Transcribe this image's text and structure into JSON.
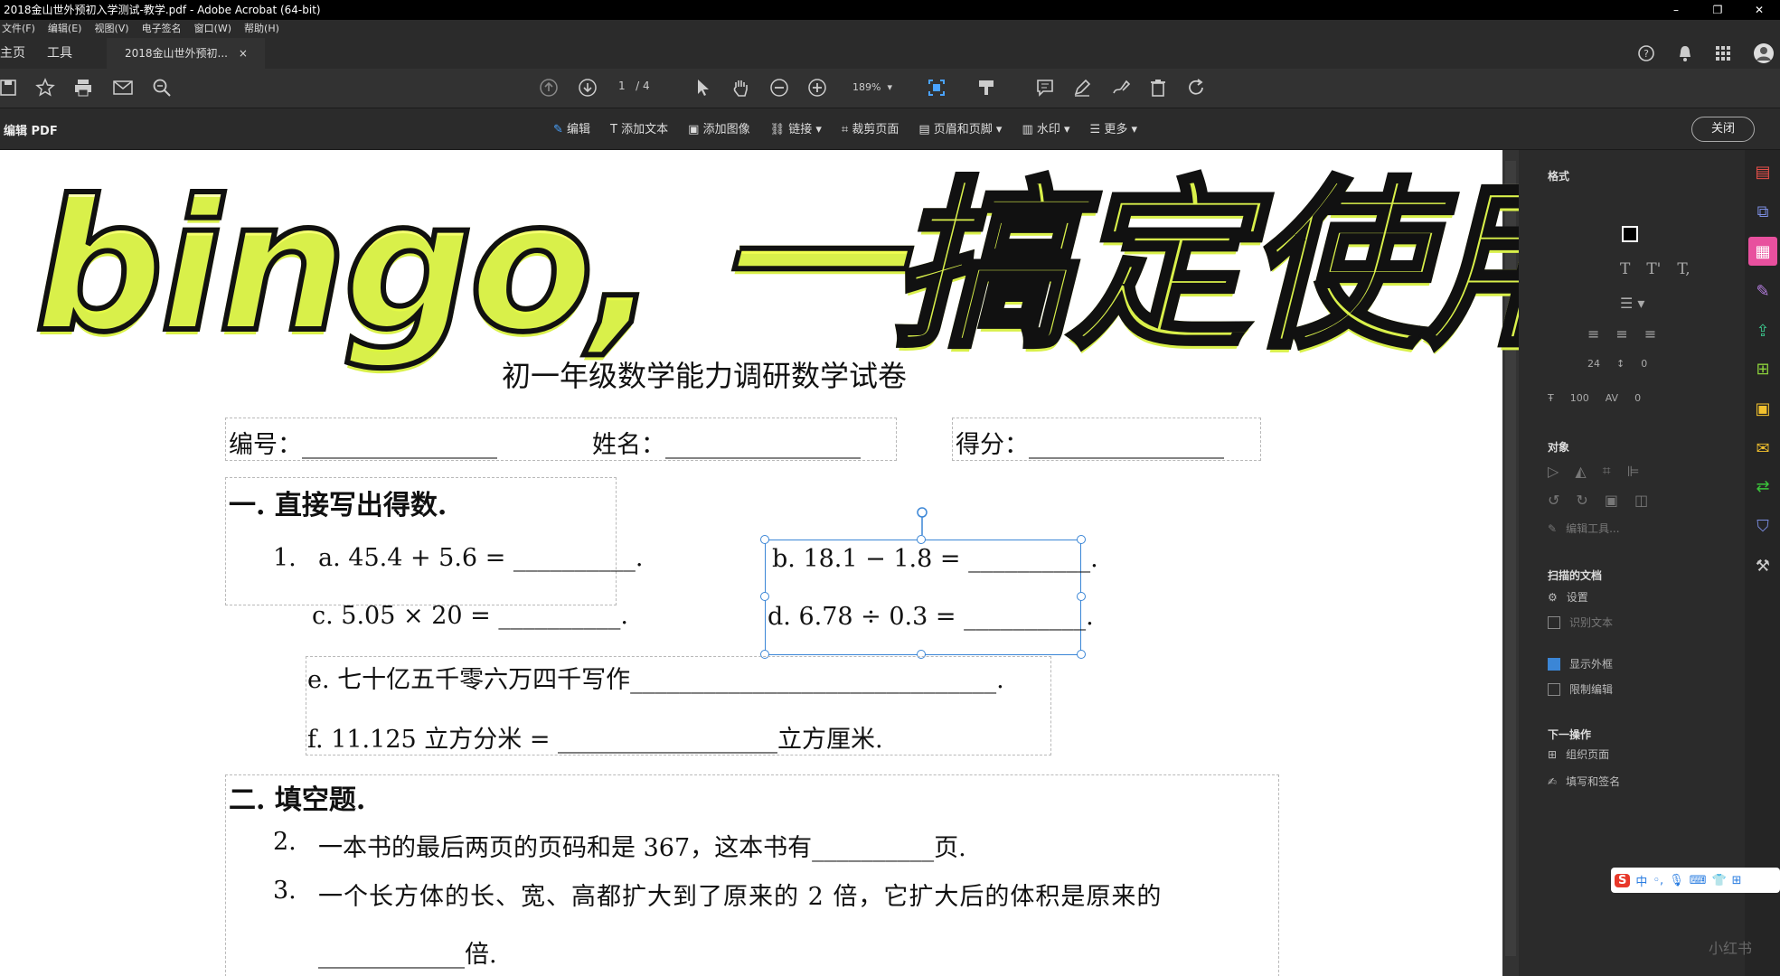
{
  "window": {
    "title": "2018金山世外预初入学测试-教学.pdf - Adobe Acrobat (64-bit)",
    "controls": [
      "–",
      "❐",
      "✕"
    ]
  },
  "menu": [
    "文件(F)",
    "编辑(E)",
    "视图(V)",
    "电子签名",
    "窗口(W)",
    "帮助(H)"
  ],
  "tabs": {
    "home": "主页",
    "tools": "工具",
    "document": "2018金山世外预初...",
    "close": "×"
  },
  "toolbar": {
    "page_current": "1",
    "page_total": "/ 4",
    "zoom": "189%"
  },
  "edit_bar": {
    "label": "编辑 PDF",
    "tools": [
      "编辑",
      "添加文本",
      "添加图像",
      "链接 ▾",
      "裁剪页面",
      "页眉和页脚 ▾",
      "水印 ▾",
      "更多 ▾"
    ],
    "close": "关闭"
  },
  "headline": "bingo, 一搞定使用",
  "document": {
    "title": "初一年级数学能力调研数学试卷",
    "fields": {
      "number": "编号：________________",
      "name": "姓名：________________",
      "score": "得分：________________"
    },
    "section1": "一. 直接写出得数.",
    "q1_num": "1.",
    "q1a": "a. 45.4 + 5.6 = __________.",
    "q1b": "b. 18.1 − 1.8 = __________.",
    "q1c": "c. 5.05 × 20 = __________.",
    "q1d": "d. 6.78 ÷ 0.3 = __________.",
    "q1e": "e. 七十亿五千零六万四千写作______________________________.",
    "q1f": "f. 11.125 立方分米 = __________________立方厘米.",
    "section2": "二. 填空题.",
    "q2_num": "2.",
    "q2": "一本书的最后两页的页码和是 367，这本书有__________页.",
    "q3_num": "3.",
    "q3": "一个长方体的长、宽、高都扩大到了原来的 2 倍，它扩大后的体积是原来的",
    "q3_cont": "____________倍."
  },
  "right_panel": {
    "format": "格式",
    "object": "对象",
    "scan_doc": "扫描的文档",
    "settings": "设置",
    "recognize_text": "识别文本",
    "show_outline": "显示外框",
    "restrict_edit": "限制编辑",
    "next_steps": "下一操作",
    "organize_pages": "组织页面",
    "fill_sign": "填写和签名",
    "edit_tool": "编辑工具...",
    "font_size": "24",
    "line_spacing": "0",
    "scale": "100",
    "char_spacing": "0"
  },
  "ime": {
    "logo": "S",
    "mode": "中"
  },
  "watermark": "小红书"
}
